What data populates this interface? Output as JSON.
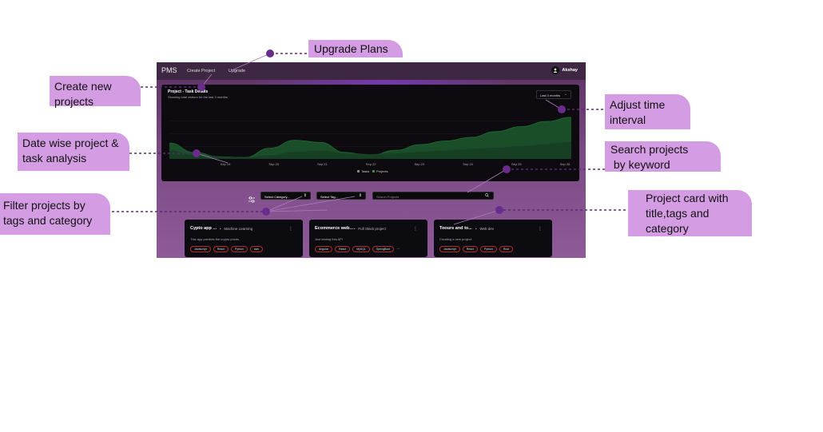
{
  "app": {
    "brand": "PMS",
    "nav": {
      "create_project": "Create Project",
      "upgrade": "Upgrade"
    },
    "user": {
      "name": "Akshay",
      "avatar_icon": "person-icon"
    },
    "chart_card": {
      "title": "Project - Task Details",
      "subtitle": "Showing total visitors for the last 3 months",
      "range_label": "Last 3 months"
    },
    "filters": {
      "category_label": "Select Category...",
      "tag_label": "Select Tag...",
      "search_placeholder": "Search Projects"
    },
    "cards": [
      {
        "title": "Cypto app ...",
        "category": "Machine Learning",
        "description": "This app predicts the crypto prices.",
        "tags": [
          "Javascript",
          "React",
          "Python",
          "aws"
        ]
      },
      {
        "title": "Ecommerce web...",
        "category": "Full Stack project",
        "description": "Just testing this API",
        "tags": [
          "Angular",
          "React",
          "MySQL",
          "SpringBoot"
        ],
        "more": "..."
      },
      {
        "title": "Toours and to...",
        "category": "Web dev",
        "description": "Creating a new project.",
        "tags": [
          "Javascript",
          "React",
          "Python",
          "Rust"
        ]
      }
    ]
  },
  "chart_data": {
    "type": "area",
    "title": "Project - Task Details",
    "subtitle": "Showing total visitors for the last 3 months",
    "x_ticks": [
      "Sep 19",
      "Sep 20",
      "Sep 21",
      "Sep 22",
      "Sep 23",
      "Sep 24",
      "Sep 25",
      "Sep 26"
    ],
    "x": [
      0,
      1,
      2,
      3,
      4,
      5,
      6,
      7,
      8,
      9,
      10,
      11,
      12,
      13,
      14,
      15,
      16
    ],
    "series": [
      {
        "name": "Tasks",
        "values": [
          22,
          9,
          3,
          2,
          15,
          26,
          23,
          9,
          5,
          12,
          20,
          25,
          30,
          38,
          45,
          52,
          58
        ]
      },
      {
        "name": "Projects",
        "values": [
          12,
          6,
          3,
          2,
          5,
          10,
          12,
          8,
          6,
          8,
          10,
          12,
          14,
          16,
          18,
          21,
          24
        ]
      }
    ],
    "ylim": [
      0,
      70
    ],
    "legend_position": "bottom",
    "grid": true,
    "colors": {
      "Tasks": "#1f6b35",
      "Projects": "#1b4a28"
    }
  },
  "annotations": [
    {
      "id": "upgrade",
      "text": [
        "Upgrade Plans"
      ]
    },
    {
      "id": "create",
      "text": [
        "Create new",
        "projects"
      ]
    },
    {
      "id": "analysis",
      "text": [
        "Date wise project &",
        "task analysis"
      ]
    },
    {
      "id": "filter",
      "text": [
        "Filter projects by",
        "tags and category"
      ]
    },
    {
      "id": "time",
      "text": [
        "Adjust time",
        "interval"
      ]
    },
    {
      "id": "search",
      "text": [
        "Search projects",
        " by keyword"
      ]
    },
    {
      "id": "cardinfo",
      "text": [
        "Project card with",
        "title,tags and",
        "category"
      ]
    }
  ],
  "colors": {
    "callout": "#d49ce3",
    "marker": "#6a2c8c",
    "dots": "#5b2a6e"
  }
}
